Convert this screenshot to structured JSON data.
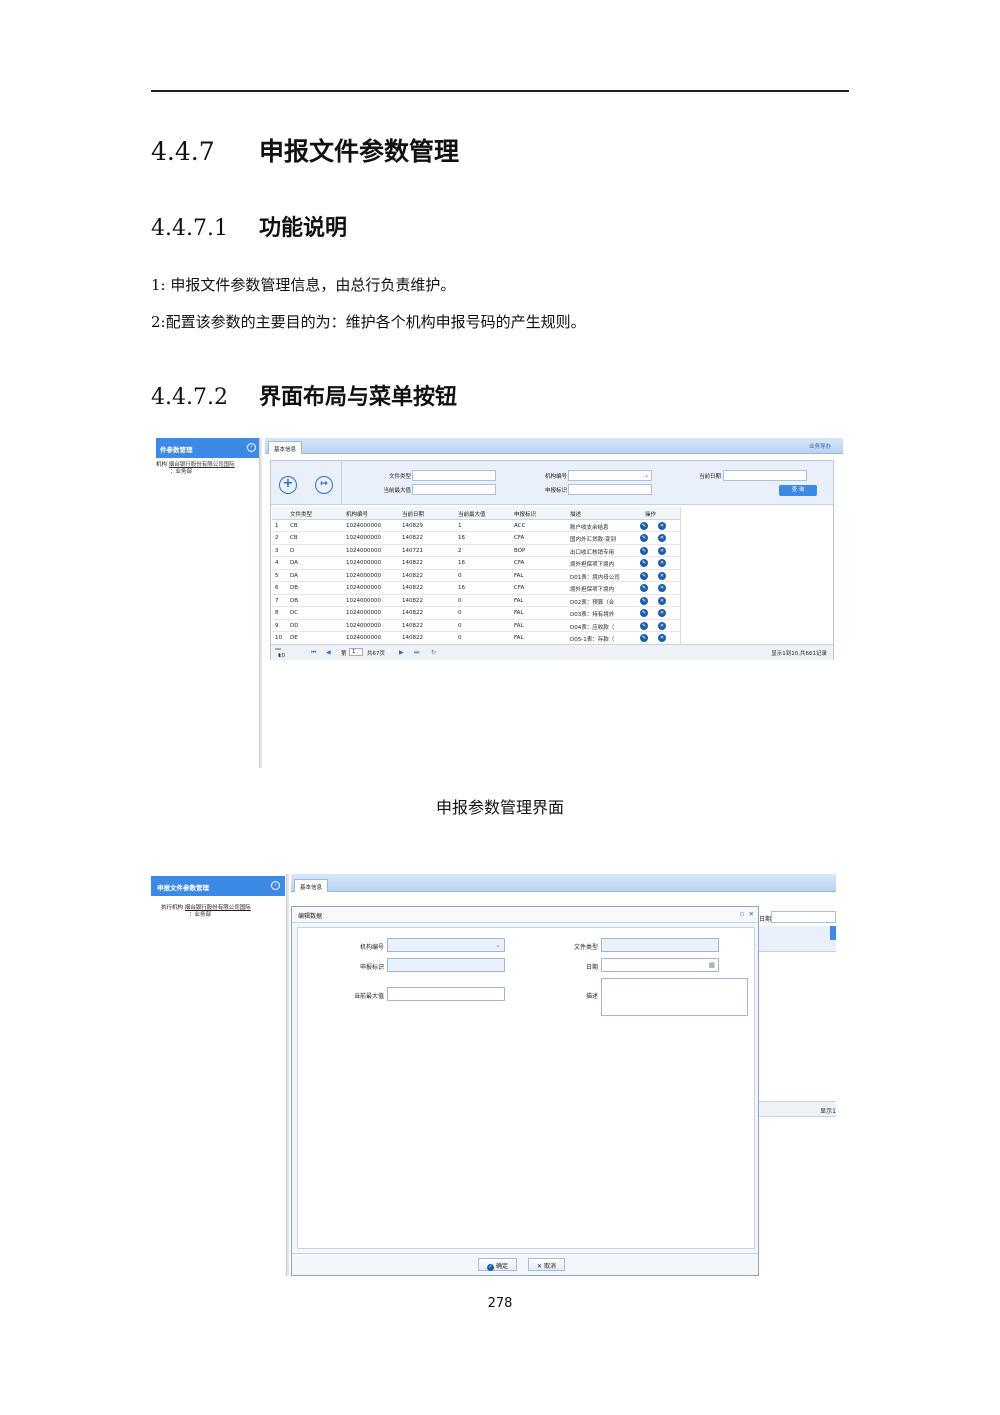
{
  "section": {
    "num": "4.4.7",
    "title": "申报文件参数管理"
  },
  "sub1": {
    "num": "4.4.7.1",
    "title": "功能说明"
  },
  "para1": "1: 申报文件参数管理信息，由总行负责维护。",
  "para2": "2:配置该参数的主要目的为：维护各个机构申报号码的产生规则。",
  "sub2": {
    "num": "4.4.7.2",
    "title": "界面布局与菜单按钮"
  },
  "caption1": "申报参数管理界面",
  "page_number": "278",
  "shot1": {
    "left_title": "件参数管理",
    "left_org_label": "机构",
    "left_org_value": "烟台银行股份有限公司国际",
    "left_org_value2": "：业务部",
    "tab_label": "基本信息",
    "tab_right": "业务导办",
    "filters": {
      "file_type": "文件类型",
      "current_max": "当前最大值",
      "org_code": "机构编号",
      "report_flag": "申报标识",
      "current_date": "当前日期",
      "query_btn": "查 询"
    },
    "columns": [
      "文件类型",
      "机构编号",
      "当前日期",
      "当前最大值",
      "申报标识",
      "描述",
      "操作"
    ],
    "rows": [
      [
        "1",
        "CB",
        "1024000000",
        "140829",
        "1",
        "ACC",
        "账户收支余结息"
      ],
      [
        "2",
        "CB",
        "1024000000",
        "140822",
        "16",
        "CFA",
        "国内外汇贷款-变到"
      ],
      [
        "3",
        "D",
        "1024000000",
        "140721",
        "2",
        "BOP",
        "出口收汇核销专用"
      ],
      [
        "4",
        "DA",
        "1024000000",
        "140822",
        "16",
        "CFA",
        "境外担保项下境内"
      ],
      [
        "5",
        "DA",
        "1024000000",
        "140822",
        "0",
        "FAL",
        "D01表：境内母公司"
      ],
      [
        "6",
        "DB",
        "1024000000",
        "140822",
        "16",
        "CFA",
        "境外担保项下境内"
      ],
      [
        "7",
        "DB",
        "1024000000",
        "140822",
        "0",
        "FAL",
        "D02表：预算（合"
      ],
      [
        "8",
        "DC",
        "1024000000",
        "140822",
        "0",
        "FAL",
        "D03表：持有境外"
      ],
      [
        "9",
        "DD",
        "1024000000",
        "140822",
        "0",
        "FAL",
        "D04表：应收款（"
      ],
      [
        "10",
        "DE",
        "1024000000",
        "140822",
        "0",
        "FAL",
        "D05-1表：存款（"
      ]
    ],
    "pager": {
      "size": "10",
      "page_prefix": "第",
      "page_value": "1",
      "page_total": "共67页",
      "summary": "显示1到10,共661记录"
    }
  },
  "shot2": {
    "left_title": "申报文件参数管理",
    "left_org_label": "执行机构",
    "left_org_value": "烟台银行股份有限公司国际",
    "left_org_value2": "：业务部",
    "tab_label": "基本信息",
    "dialog_title": "编辑数据",
    "behind_label": "日期",
    "behind_summary": "显示1",
    "fields": {
      "org_code": "机构编号",
      "file_type": "文件类型",
      "report_flag": "申报标识",
      "date": "日期",
      "current_max": "当前最大值",
      "desc": "描述"
    },
    "ok_btn": "确定",
    "cancel_btn": "取消"
  }
}
